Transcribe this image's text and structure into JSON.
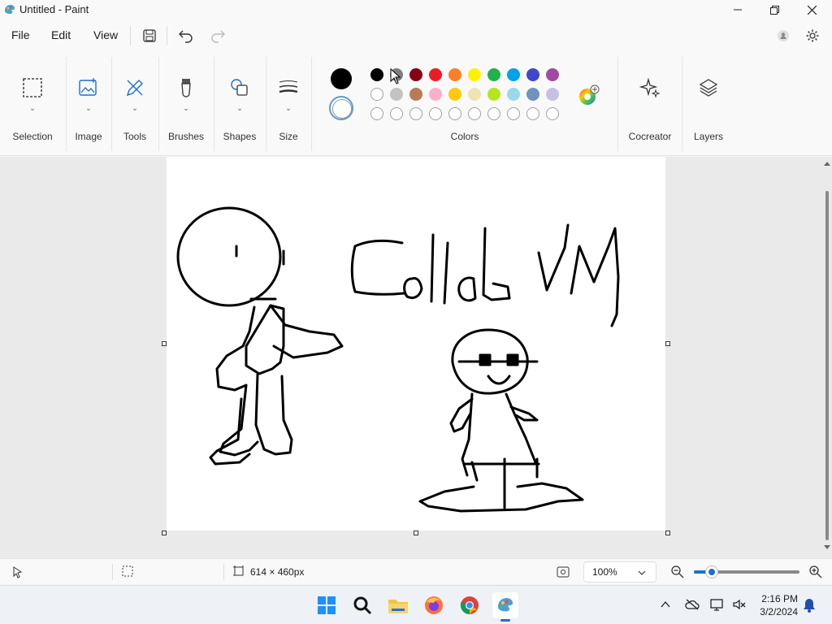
{
  "window": {
    "title": "Untitled - Paint"
  },
  "menu": {
    "file": "File",
    "edit": "Edit",
    "view": "View"
  },
  "ribbon": {
    "groups": [
      "Selection",
      "Image",
      "Tools",
      "Brushes",
      "Shapes",
      "Size",
      "Colors",
      "Cocreator",
      "Layers"
    ]
  },
  "colors": {
    "primary": "#000000",
    "row1": [
      "#000000",
      "#7f7f7f",
      "#880015",
      "#ed1c24",
      "#ff7f27",
      "#fff200",
      "#22b14c",
      "#00a2e8",
      "#3f48cc",
      "#a349a4"
    ],
    "row2": [
      "#ffffff",
      "#c3c3c3",
      "#b97a57",
      "#ffaec9",
      "#ffc90e",
      "#efe4b0",
      "#b5e61d",
      "#99d9ea",
      "#7092be",
      "#c8bfe7"
    ]
  },
  "canvas": {
    "drawing_text": "Collab VM"
  },
  "status": {
    "canvas_size": "614 × 460px",
    "zoom": "100%"
  },
  "taskbar": {
    "time": "2:16 PM",
    "date": "3/2/2024"
  }
}
